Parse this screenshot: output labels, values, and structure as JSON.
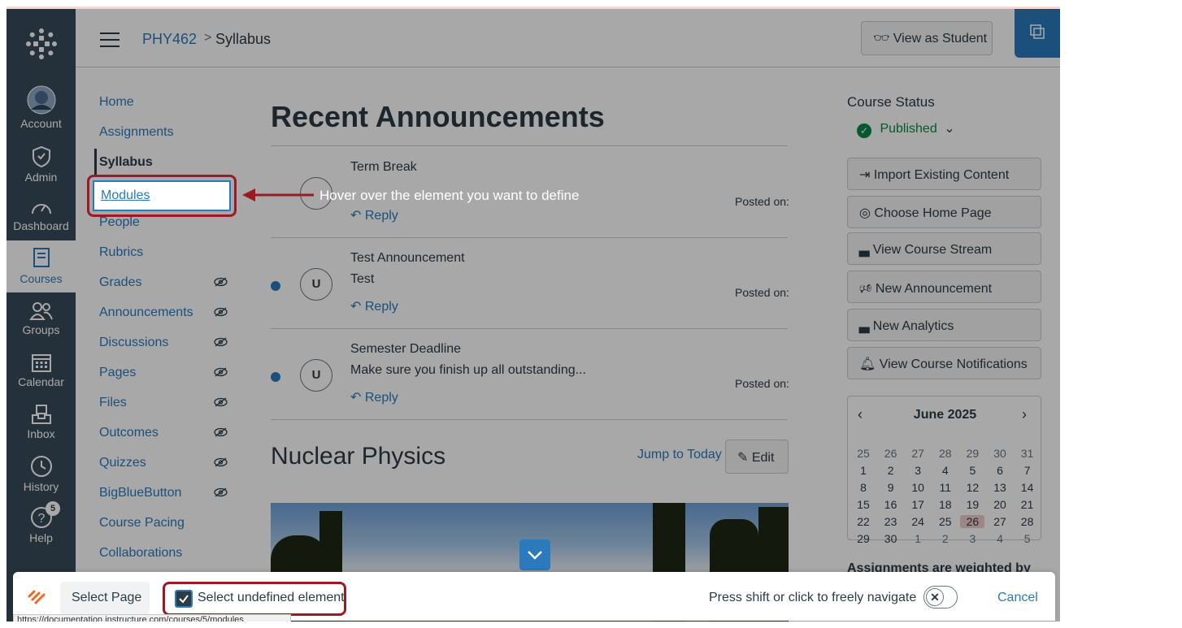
{
  "global_nav": {
    "account": "Account",
    "admin": "Admin",
    "dashboard": "Dashboard",
    "courses": "Courses",
    "groups": "Groups",
    "calendar": "Calendar",
    "inbox": "Inbox",
    "history": "History",
    "help": "Help",
    "help_badge": "5"
  },
  "header": {
    "course": "PHY462",
    "separator": ">",
    "page": "Syllabus",
    "view_as_student": "View as Student"
  },
  "course_nav": [
    {
      "label": "Home",
      "hidden": false
    },
    {
      "label": "Assignments",
      "hidden": false
    },
    {
      "label": "Syllabus",
      "hidden": false,
      "current": true
    },
    {
      "label": "Modules",
      "hidden": false
    },
    {
      "label": "People",
      "hidden": false
    },
    {
      "label": "Rubrics",
      "hidden": false
    },
    {
      "label": "Grades",
      "hidden": true
    },
    {
      "label": "Announcements",
      "hidden": true
    },
    {
      "label": "Discussions",
      "hidden": true
    },
    {
      "label": "Pages",
      "hidden": true
    },
    {
      "label": "Files",
      "hidden": true
    },
    {
      "label": "Outcomes",
      "hidden": true
    },
    {
      "label": "Quizzes",
      "hidden": true
    },
    {
      "label": "BigBlueButton",
      "hidden": true
    },
    {
      "label": "Course Pacing",
      "hidden": false
    },
    {
      "label": "Collaborations",
      "hidden": false
    }
  ],
  "main": {
    "recent_heading": "Recent Announcements",
    "announcements": [
      {
        "title": "Term Break",
        "body": "",
        "avatar": "",
        "reply": "Reply",
        "posted": "Posted on:"
      },
      {
        "title": "Test Announcement",
        "body": "Test",
        "avatar": "U",
        "reply": "Reply",
        "posted": "Posted on:"
      },
      {
        "title": "Semester Deadline",
        "body": "Make sure you finish up all outstanding...",
        "avatar": "U",
        "reply": "Reply",
        "posted": "Posted on:"
      }
    ],
    "course_title": "Nuclear Physics",
    "jump_today": "Jump to Today",
    "edit": "Edit"
  },
  "sidebar": {
    "course_status": "Course Status",
    "published": "Published",
    "buttons": [
      "Import Existing Content",
      "Choose Home Page",
      "View Course Stream",
      "New Announcement",
      "New Analytics",
      "View Course Notifications"
    ],
    "calendar": {
      "month": "June 2025",
      "weeks": [
        [
          "25",
          "26",
          "27",
          "28",
          "29",
          "30",
          "31"
        ],
        [
          "1",
          "2",
          "3",
          "4",
          "5",
          "6",
          "7"
        ],
        [
          "8",
          "9",
          "10",
          "11",
          "12",
          "13",
          "14"
        ],
        [
          "15",
          "16",
          "17",
          "18",
          "19",
          "20",
          "21"
        ],
        [
          "22",
          "23",
          "24",
          "25",
          "26",
          "27",
          "28"
        ],
        [
          "29",
          "30",
          "1",
          "2",
          "3",
          "4",
          "5"
        ]
      ],
      "today": "26"
    },
    "weighted": "Assignments are weighted by"
  },
  "overlay": {
    "tooltip": "Hover over the element you want to define",
    "select_page": "Select Page",
    "select_undefined": "Select undefined element",
    "press_shift": "Press shift or click to freely navigate",
    "cancel": "Cancel",
    "status_url": "https://documentation.instructure.com/courses/5/modules"
  },
  "colors": {
    "nav_bg": "#394b58",
    "link": "#2b7abc",
    "text": "#2d3b45",
    "published": "#0b874b",
    "highlight_border": "#9b1b24"
  }
}
